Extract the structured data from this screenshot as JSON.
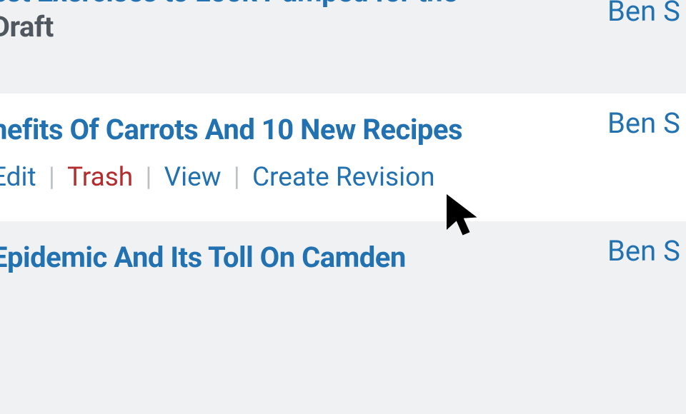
{
  "rows": [
    {
      "title_line1": "est Exercises to Look Pumped for the",
      "draft_status": "Draft",
      "author": "Ben S"
    },
    {
      "title": "nefits Of Carrots And 10 New Recipes",
      "author": "Ben S",
      "actions": {
        "edit": "Edit",
        "trash": "Trash",
        "view": "View",
        "create_revision": "Create Revision"
      }
    },
    {
      "title": "Epidemic And Its Toll On Camden",
      "author": "Ben S"
    }
  ],
  "separator": " | "
}
